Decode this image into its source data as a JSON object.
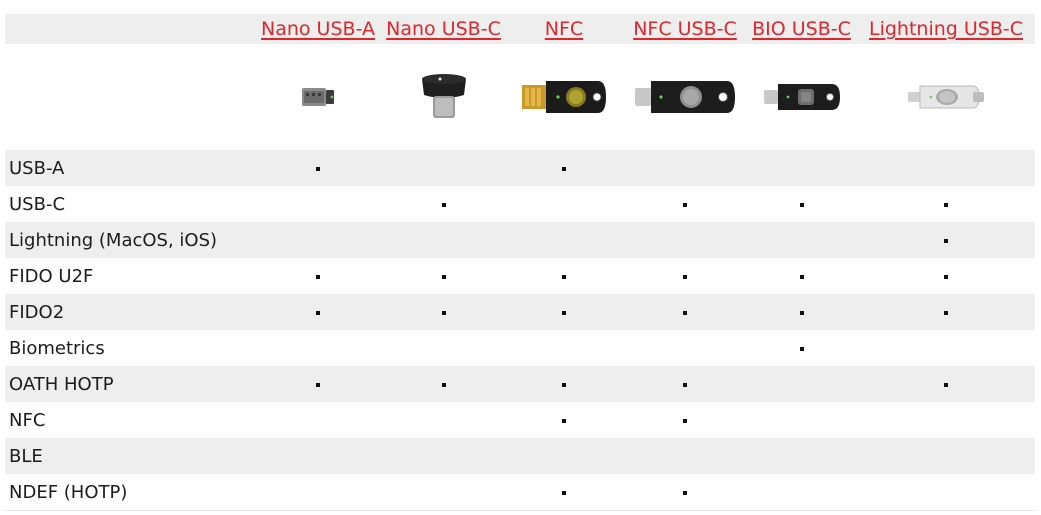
{
  "models": [
    {
      "label": "Nano USB-A",
      "icon": "nano-usb-a-key-icon"
    },
    {
      "label": "Nano USB-C",
      "icon": "nano-usb-c-key-icon"
    },
    {
      "label": "NFC",
      "icon": "nfc-key-icon"
    },
    {
      "label": "NFC USB-C",
      "icon": "nfc-usb-c-key-icon"
    },
    {
      "label": "BIO USB-C",
      "icon": "bio-usb-c-key-icon"
    },
    {
      "label": "Lightning USB-C",
      "icon": "lightning-usb-c-key-icon"
    }
  ],
  "colors": {
    "link": "#e0262b",
    "row_shade": "#eeeeee",
    "text": "#1c1c1c"
  },
  "features": [
    {
      "label": "USB-A",
      "support": [
        true,
        false,
        true,
        false,
        false,
        false
      ]
    },
    {
      "label": "USB-C",
      "support": [
        false,
        true,
        false,
        true,
        true,
        true
      ]
    },
    {
      "label": "Lightning (MacOS, iOS)",
      "support": [
        false,
        false,
        false,
        false,
        false,
        true
      ]
    },
    {
      "label": "FIDO U2F",
      "support": [
        true,
        true,
        true,
        true,
        true,
        true
      ]
    },
    {
      "label": "FIDO2",
      "support": [
        true,
        true,
        true,
        true,
        true,
        true
      ]
    },
    {
      "label": "Biometrics",
      "support": [
        false,
        false,
        false,
        false,
        true,
        false
      ]
    },
    {
      "label": "OATH HOTP",
      "support": [
        true,
        true,
        true,
        true,
        false,
        true
      ]
    },
    {
      "label": "NFC",
      "support": [
        false,
        false,
        true,
        true,
        false,
        false
      ]
    },
    {
      "label": "BLE",
      "support": [
        false,
        false,
        false,
        false,
        false,
        false
      ]
    },
    {
      "label": "NDEF (HOTP)",
      "support": [
        false,
        false,
        true,
        true,
        false,
        false
      ]
    }
  ]
}
